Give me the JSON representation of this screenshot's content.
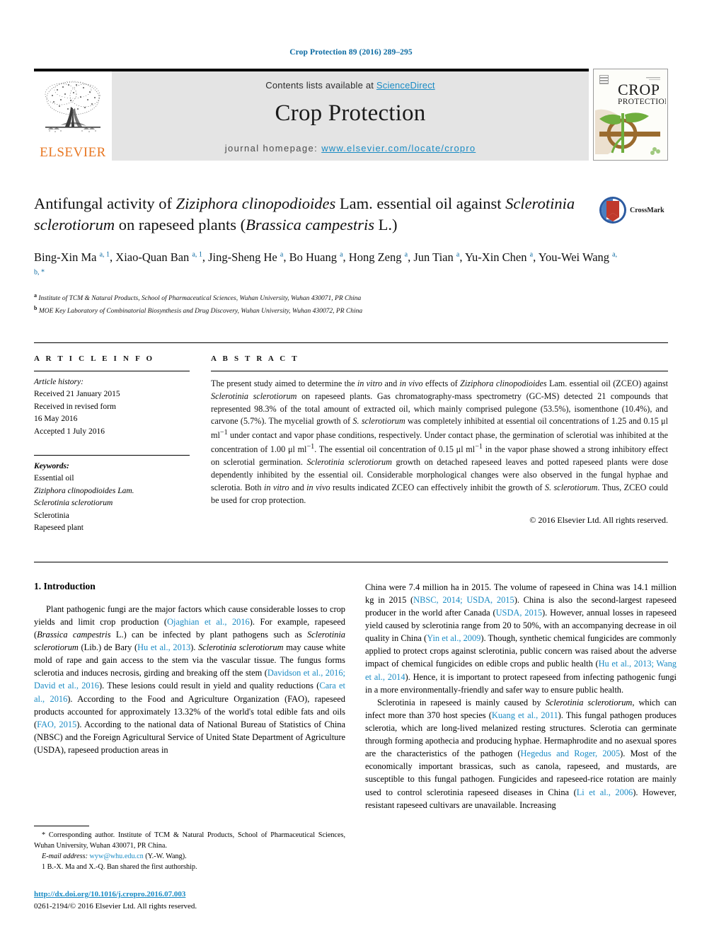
{
  "running_head": "Crop Protection 89 (2016) 289–295",
  "masthead": {
    "contents_prefix": "Contents lists available at ",
    "sciencedirect": "ScienceDirect",
    "journal_name": "Crop Protection",
    "homepage_prefix": "journal homepage: ",
    "homepage_url": "www.elsevier.com/locate/cropro",
    "publisher": "ELSEVIER",
    "cover_title_line1": "CROP",
    "cover_title_line2": "PROTECTION",
    "accent_orange": "#e87722",
    "link_blue": "#1a8bc4",
    "head_blue": "#0b6aa2"
  },
  "title": {
    "line1_a": "Antifungal activity of ",
    "line1_i": "Ziziphora clinopodioides",
    "line1_b": " Lam. essential oil against ",
    "line2_i1": "Sclerotinia sclerotiorum",
    "line2_b": " on rapeseed plants (",
    "line2_i2": "Brassica campestris",
    "line2_c": " L.)",
    "crossmark_label": "CrossMark"
  },
  "authors": {
    "list": [
      {
        "name": "Bing-Xin Ma",
        "sup": "a, 1"
      },
      {
        "name": "Xiao-Quan Ban",
        "sup": "a, 1"
      },
      {
        "name": "Jing-Sheng He",
        "sup": "a"
      },
      {
        "name": "Bo Huang",
        "sup": "a"
      },
      {
        "name": "Hong Zeng",
        "sup": "a"
      },
      {
        "name": "Jun Tian",
        "sup": "a"
      },
      {
        "name": "Yu-Xin Chen",
        "sup": "a"
      },
      {
        "name": "You-Wei Wang",
        "sup": "a, b, *"
      }
    ],
    "affiliations": [
      {
        "marker": "a",
        "text": "Institute of TCM & Natural Products, School of Pharmaceutical Sciences, Wuhan University, Wuhan 430071, PR China"
      },
      {
        "marker": "b",
        "text": "MOE Key Laboratory of Combinatorial Biosynthesis and Drug Discovery, Wuhan University, Wuhan 430072, PR China"
      }
    ]
  },
  "article_info": {
    "heading": "A R T I C L E  I N F O",
    "history_label": "Article history:",
    "history": [
      "Received 21 January 2015",
      "Received in revised form",
      "16 May 2016",
      "Accepted 1 July 2016"
    ],
    "keywords_label": "Keywords:",
    "keywords": [
      "Essential oil",
      "Ziziphora clinopodioides Lam.",
      "Sclerotinia sclerotiorum",
      "Sclerotinia",
      "Rapeseed plant"
    ]
  },
  "abstract": {
    "heading": "A B S T R A C T",
    "text": "The present study aimed to determine the in vitro and in vivo effects of Ziziphora clinopodioides Lam. essential oil (ZCEO) against Sclerotinia sclerotiorum on rapeseed plants. Gas chromatography-mass spectrometry (GC-MS) detected 21 compounds that represented 98.3% of the total amount of extracted oil, which mainly comprised pulegone (53.5%), isomenthone (10.4%), and carvone (5.7%). The mycelial growth of S. sclerotiorum was completely inhibited at essential oil concentrations of 1.25 and 0.15 μl ml−1 under contact and vapor phase conditions, respectively. Under contact phase, the germination of sclerotial was inhibited at the concentration of 1.00 μl ml−1. The essential oil concentration of 0.15 μl ml−1 in the vapor phase showed a strong inhibitory effect on sclerotial germination. Sclerotinia sclerotiorum growth on detached rapeseed leaves and potted rapeseed plants were dose dependently inhibited by the essential oil. Considerable morphological changes were also observed in the fungal hyphae and sclerotia. Both in vitro and in vivo results indicated ZCEO can effectively inhibit the growth of S. sclerotiorum. Thus, ZCEO could be used for crop protection.",
    "copyright": "© 2016 Elsevier Ltd. All rights reserved."
  },
  "introduction": {
    "section_number_title": "1.  Introduction",
    "left_paragraph": "Plant pathogenic fungi are the major factors which cause considerable losses to crop yields and limit crop production (Ojaghian et al., 2016). For example, rapeseed (Brassica campestris L.) can be infected by plant pathogens such as Sclerotinia sclerotiorum (Lib.) de Bary (Hu et al., 2013). Sclerotinia sclerotiorum may cause white mold of rape and gain access to the stem via the vascular tissue. The fungus forms sclerotia and induces necrosis, girding and breaking off the stem (Davidson et al., 2016; David et al., 2016). These lesions could result in yield and quality reductions (Cara et al., 2016). According to the Food and Agriculture Organization (FAO), rapeseed products accounted for approximately 13.32% of the world's total edible fats and oils (FAO, 2015). According to the national data of National Bureau of Statistics of China (NBSC) and the Foreign Agricultural Service of United State Department of Agriculture (USDA), rapeseed production areas in",
    "right_paragraph_1": "China were 7.4 million ha in 2015. The volume of rapeseed in China was 14.1 million kg in 2015 (NBSC, 2014; USDA, 2015). China is also the second-largest rapeseed producer in the world after Canada (USDA, 2015). However, annual losses in rapeseed yield caused by sclerotinia range from 20 to 50%, with an accompanying decrease in oil quality in China (Yin et al., 2009). Though, synthetic chemical fungicides are commonly applied to protect crops against sclerotinia, public concern was raised about the adverse impact of chemical fungicides on edible crops and public health (Hu et al., 2013; Wang et al., 2014). Hence, it is important to protect rapeseed from infecting pathogenic fungi in a more environmentally-friendly and safer way to ensure public health.",
    "right_paragraph_2": "Sclerotinia in rapeseed is mainly caused by Sclerotinia sclerotiorum, which can infect more than 370 host species (Kuang et al., 2011). This fungal pathogen produces sclerotia, which are long-lived melanized resting structures. Sclerotia can germinate through forming apothecia and producing hyphae. Hermaphrodite and no asexual spores are the characteristics of the pathogen (Hegedus and Roger, 2005). Most of the economically important brassicas, such as canola, rapeseed, and mustards, are susceptible to this fungal pathogen. Fungicides and rapeseed-rice rotation are mainly used to control sclerotinia rapeseed diseases in China (Li et al., 2006). However, resistant rapeseed cultivars are unavailable. Increasing"
  },
  "footnotes": {
    "corresponding": "* Corresponding author. Institute of TCM & Natural Products, School of Pharmaceutical Sciences, Wuhan University, Wuhan 430071, PR China.",
    "email_label": "E-mail address:",
    "email": "wyw@whu.edu.cn",
    "email_suffix": "(Y.-W. Wang).",
    "first_authorship": "1  B.-X. Ma and X.-Q. Ban shared the first authorship.",
    "doi": "http://dx.doi.org/10.1016/j.cropro.2016.07.003",
    "issn_copyright": "0261-2194/© 2016 Elsevier Ltd. All rights reserved."
  }
}
